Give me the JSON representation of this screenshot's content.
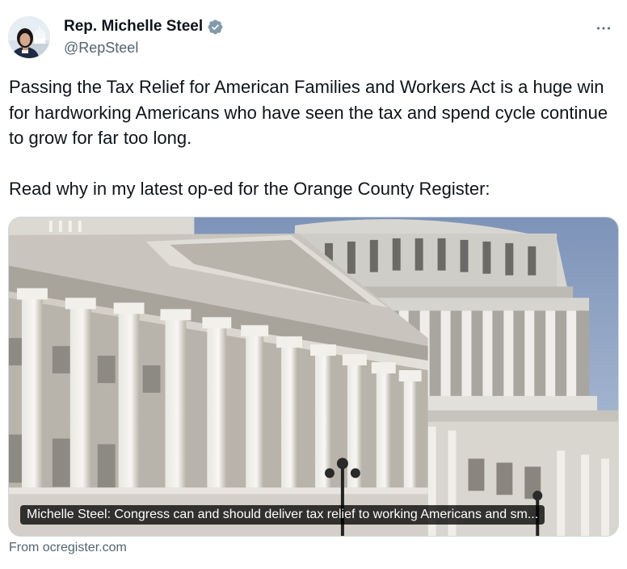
{
  "author": {
    "display_name": "Rep. Michelle Steel",
    "handle": "@RepSteel",
    "verified": true,
    "verified_color": "#829aab"
  },
  "tweet": {
    "text": "Passing the Tax Relief for American Families and Workers Act is a huge win for hardworking Americans who have seen the tax and spend cycle continue to grow for far too long.\n\nRead why in my latest op-ed for the Orange County Register:"
  },
  "link_card": {
    "image": "us-capitol-building",
    "title": "Michelle Steel: Congress can and should deliver tax relief to working Americans and sm...",
    "source": "From ocregister.com"
  },
  "icons": {
    "more": "more-horizontal-icon",
    "verified": "verified-badge-icon"
  },
  "colors": {
    "text": "#0f1419",
    "secondary": "#536471",
    "border": "#cfd9de"
  }
}
